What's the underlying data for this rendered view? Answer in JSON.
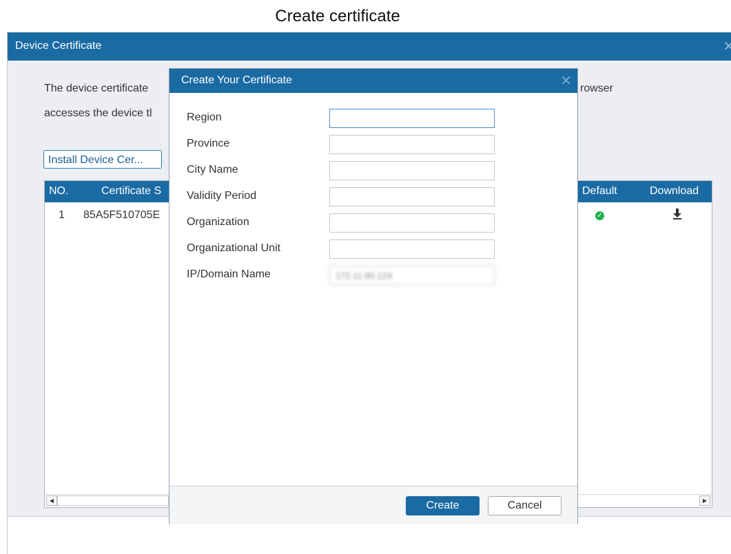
{
  "caption": "Create certificate",
  "window": {
    "title": "Device Certificate",
    "close_icon": "close-icon"
  },
  "description": {
    "line1_visible": "The device certificate",
    "line1_tail": "rowser",
    "line2_visible": "accesses the device tl"
  },
  "install_button_label": "Install Device Cer...",
  "table": {
    "headers": {
      "no": "NO.",
      "certificate": "Certificate S",
      "default": "Default",
      "download": "Download"
    },
    "rows": [
      {
        "no": "1",
        "certificate": "85A5F510705E",
        "default_icon": "check-circle-icon",
        "download_icon": "download-icon"
      }
    ]
  },
  "modal": {
    "title": "Create Your Certificate",
    "fields": [
      {
        "label": "Region",
        "value": ""
      },
      {
        "label": "Province",
        "value": ""
      },
      {
        "label": "City Name",
        "value": ""
      },
      {
        "label": "Validity Period",
        "value": ""
      },
      {
        "label": "Organization",
        "value": ""
      },
      {
        "label": "Organizational Unit",
        "value": ""
      },
      {
        "label": "IP/Domain Name",
        "value": "172.11.80.124"
      }
    ],
    "create_label": "Create",
    "cancel_label": "Cancel"
  },
  "colors": {
    "accent": "#1a6aa3",
    "status_ok": "#22b14c"
  }
}
